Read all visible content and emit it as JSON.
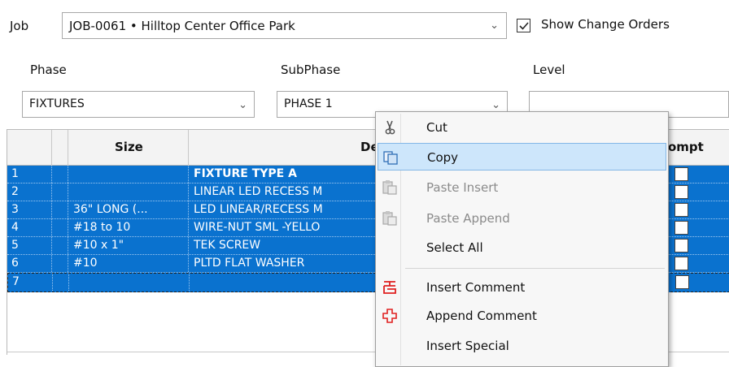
{
  "form": {
    "job_label": "Job",
    "job_value": "JOB-0061 • Hilltop Center Office Park",
    "show_change_orders_label": "Show Change Orders",
    "show_change_orders_checked": true,
    "phase_label": "Phase",
    "phase_value": "FIXTURES",
    "subphase_label": "SubPhase",
    "subphase_value": "PHASE 1",
    "level_label": "Level",
    "level_value": ""
  },
  "grid": {
    "columns": {
      "size": "Size",
      "description": "Desc",
      "prompt": "ompt"
    },
    "rows": [
      {
        "num": "1",
        "size": "",
        "description": "FIXTURE TYPE A"
      },
      {
        "num": "2",
        "size": "",
        "description": "LINEAR LED RECESS M"
      },
      {
        "num": "3",
        "size": "36\" LONG (...",
        "description": "LED LINEAR/RECESS M"
      },
      {
        "num": "4",
        "size": "#18 to 10",
        "description": "WIRE-NUT SML -YELLO"
      },
      {
        "num": "5",
        "size": "#10 x 1\"",
        "description": "TEK SCREW"
      },
      {
        "num": "6",
        "size": "#10",
        "description": "PLTD FLAT WASHER"
      },
      {
        "num": "7",
        "size": "",
        "description": ""
      }
    ]
  },
  "context_menu": {
    "cut": "Cut",
    "copy": "Copy",
    "paste_insert": "Paste Insert",
    "paste_append": "Paste Append",
    "select_all": "Select All",
    "insert_comment": "Insert Comment",
    "append_comment": "Append Comment",
    "insert_special": "Insert Special"
  },
  "colors": {
    "selection_blue": "#0a72cf",
    "menu_highlight": "#cde6fb",
    "comment_icon_red": "#e02020"
  }
}
